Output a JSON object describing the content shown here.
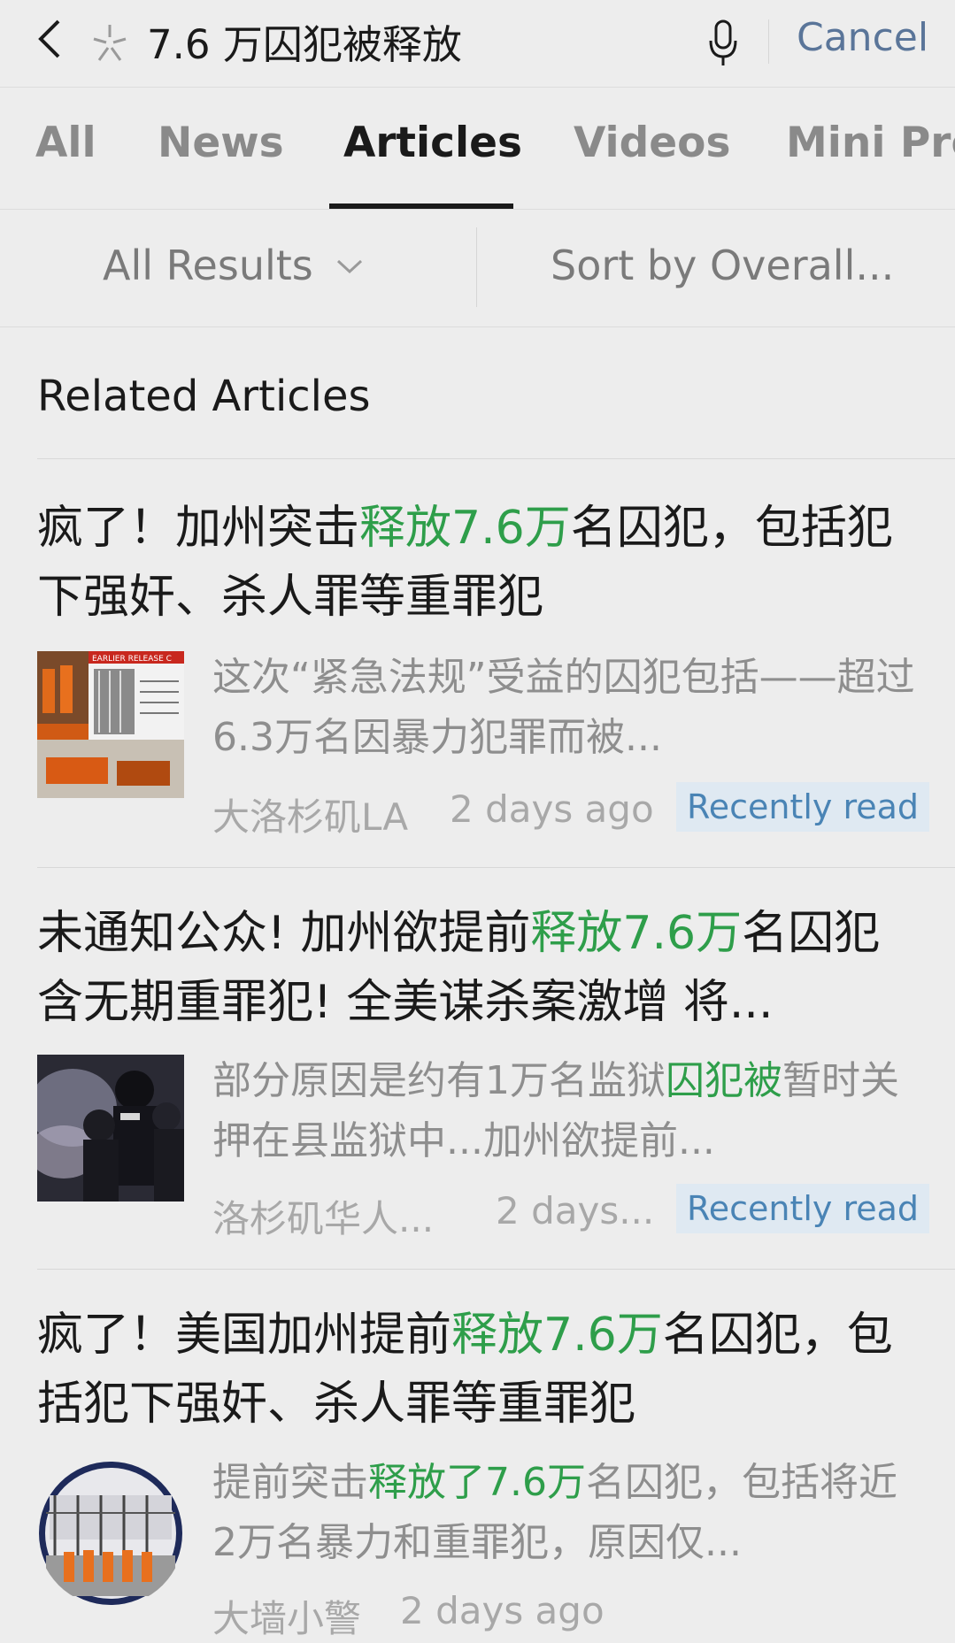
{
  "search": {
    "query": "7.6 万囚犯被释放",
    "cancel_label": "Cancel"
  },
  "tabs": [
    {
      "label": "All"
    },
    {
      "label": "News"
    },
    {
      "label": "Articles"
    },
    {
      "label": "Videos"
    },
    {
      "label": "Mini Pro"
    }
  ],
  "filters": {
    "scope_label": "All Results",
    "sort_label": "Sort by Overall..."
  },
  "section_title": "Related Articles",
  "articles": [
    {
      "title_a": "疯了！加州突击",
      "title_hl": "释放7.6万",
      "title_b": "名囚犯，包括犯下强奸、杀人罪等重罪犯",
      "snippet_a": "这次“紧急法规”受益的囚犯包括——超过6.3万名因暴力犯罪而被...",
      "source": "大洛杉矶LA",
      "time": "2 days ago",
      "badge": "Recently read",
      "thumb_text": "EARLIER RELEASE C"
    },
    {
      "title_a": "未通知公众! 加州欲提前",
      "title_hl": "释放7.6万",
      "title_b": "名囚犯 含无期重罪犯! 全美谋杀案激增 将...",
      "snippet_a": "部分原因是约有1万名监狱",
      "snippet_hl": "囚犯被",
      "snippet_b": "暂时关押在县监狱中...加州欲提前...",
      "source": "洛杉矶华人...",
      "time": "2 days...",
      "badge": "Recently read"
    },
    {
      "title_a": "疯了！美国加州提前",
      "title_hl": "释放7.6万",
      "title_b": "名囚犯，包括犯下强奸、杀人罪等重罪犯",
      "snippet_a": "提前突击",
      "snippet_hl": "释放了7.6万",
      "snippet_b": "名囚犯，包括将近2万名暴力和重罪犯，原因仅...",
      "source": "大墙小警",
      "time": "2 days ago"
    }
  ],
  "colors": {
    "highlight": "#2e9e4a",
    "link": "#5a7599",
    "badge_bg": "#dfe9f2",
    "badge_text": "#4a84b5"
  }
}
